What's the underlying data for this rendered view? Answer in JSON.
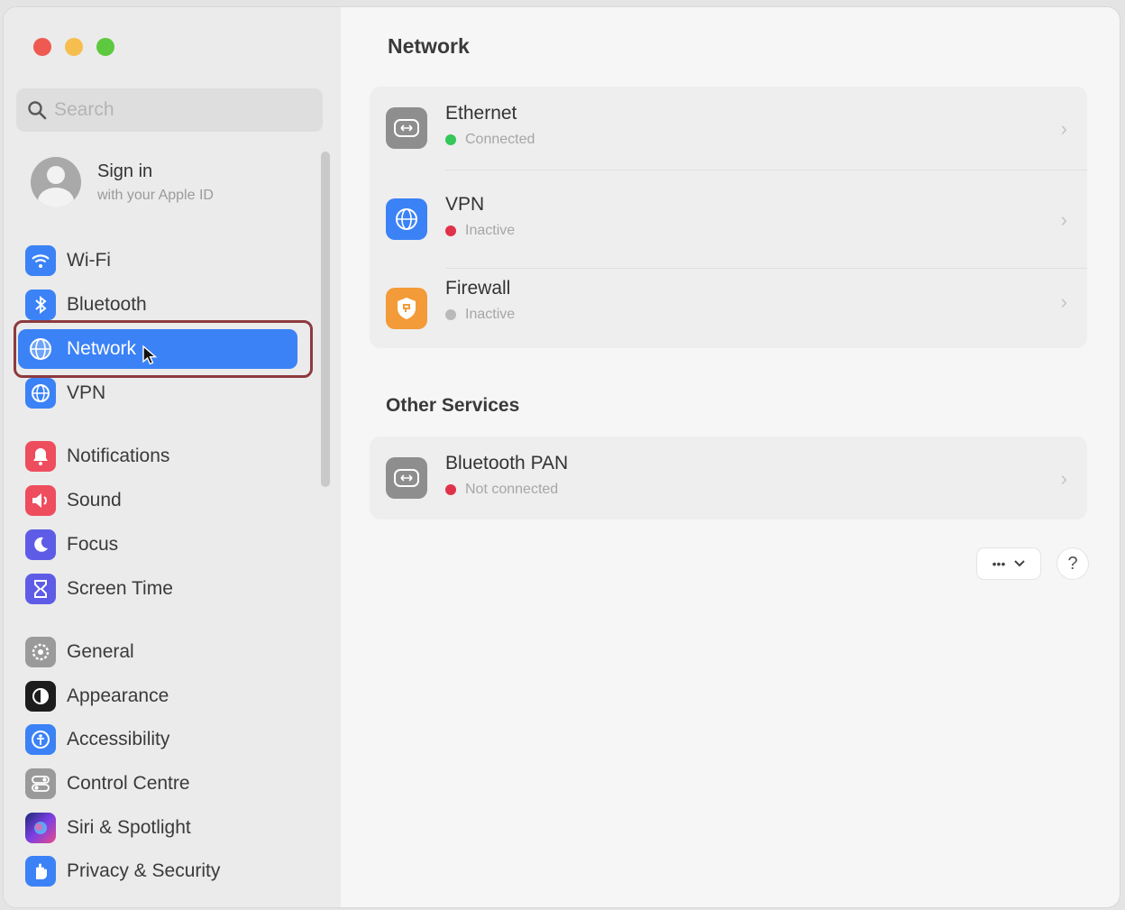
{
  "window": {
    "controls": [
      "close",
      "minimize",
      "zoom"
    ]
  },
  "search": {
    "placeholder": "Search"
  },
  "account": {
    "title": "Sign in",
    "subtitle": "with your Apple ID"
  },
  "sidebar": {
    "items": [
      {
        "label": "Wi-Fi",
        "icon": "wifi-icon",
        "color": "#3b82f6"
      },
      {
        "label": "Bluetooth",
        "icon": "bluetooth-icon",
        "color": "#3b82f6"
      },
      {
        "label": "Network",
        "icon": "globe-icon",
        "color": "#3b82f6",
        "selected": true
      },
      {
        "label": "VPN",
        "icon": "vpn-globe-icon",
        "color": "#3b82f6"
      },
      {
        "label": "Notifications",
        "icon": "bell-icon",
        "color": "#ee4d5e"
      },
      {
        "label": "Sound",
        "icon": "speaker-icon",
        "color": "#ee4d5e"
      },
      {
        "label": "Focus",
        "icon": "moon-icon",
        "color": "#5e5ce6"
      },
      {
        "label": "Screen Time",
        "icon": "hourglass-icon",
        "color": "#5e5ce6"
      },
      {
        "label": "General",
        "icon": "gear-icon",
        "color": "#9a9a9a"
      },
      {
        "label": "Appearance",
        "icon": "appearance-icon",
        "color": "#1c1c1c"
      },
      {
        "label": "Accessibility",
        "icon": "accessibility-icon",
        "color": "#3b82f6"
      },
      {
        "label": "Control Centre",
        "icon": "toggles-icon",
        "color": "#9a9a9a"
      },
      {
        "label": "Siri & Spotlight",
        "icon": "siri-icon",
        "color": "#7b3fe4"
      },
      {
        "label": "Privacy & Security",
        "icon": "hand-icon",
        "color": "#3b82f6"
      }
    ]
  },
  "main": {
    "title": "Network",
    "services": [
      {
        "name": "Ethernet",
        "status": "Connected",
        "status_color": "#34c759",
        "icon": "ethernet-icon",
        "icon_color": "#8e8e8e"
      },
      {
        "name": "VPN",
        "status": "Inactive",
        "status_color": "#e0324a",
        "icon": "vpn-globe-icon",
        "icon_color": "#3b82f6"
      },
      {
        "name": "Firewall",
        "status": "Inactive",
        "status_color": "#b9b9b9",
        "icon": "shield-icon",
        "icon_color": "#f29b38"
      }
    ],
    "other_title": "Other Services",
    "other_services": [
      {
        "name": "Bluetooth PAN",
        "status": "Not connected",
        "status_color": "#e0324a",
        "icon": "ethernet-icon",
        "icon_color": "#8e8e8e"
      }
    ],
    "more_label": "•••",
    "help_label": "?"
  }
}
